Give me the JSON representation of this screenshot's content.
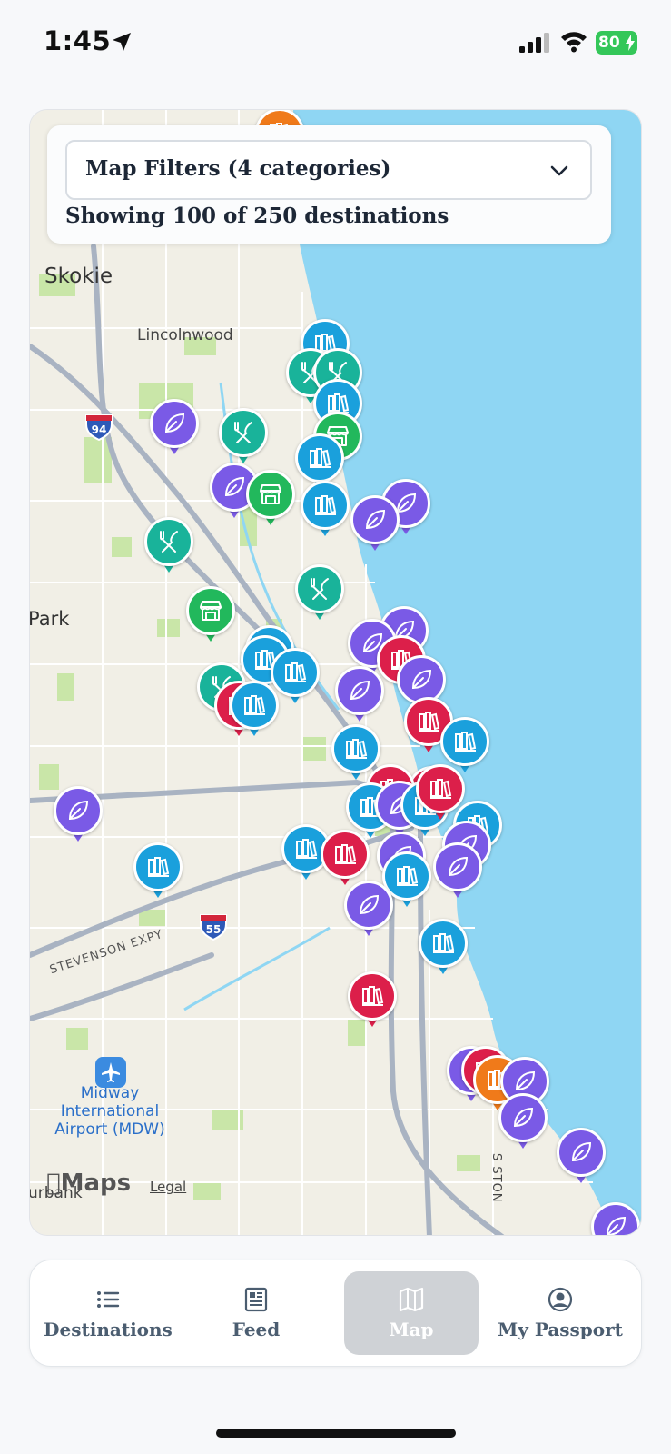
{
  "status_bar": {
    "time": "1:45",
    "battery": "80",
    "icons": [
      "location-arrow-icon",
      "cellular-signal-icon",
      "wifi-icon",
      "battery-charging-icon"
    ]
  },
  "map": {
    "labels": {
      "skokie": "Skokie",
      "lincolnwood": "Lincolnwood",
      "park": "Park",
      "stevenson": "STEVENSON EXPY",
      "midway_line1": "Midway",
      "midway_line2": "International",
      "midway_line3": "Airport (MDW)",
      "s_ston": "S STON",
      "urbank": "urbank"
    },
    "shields": {
      "i94": "94",
      "i55": "55"
    },
    "attribution": {
      "maps": "Maps",
      "legal": "Legal"
    }
  },
  "filters": {
    "select_label": "Map Filters (4 categories)",
    "showing": "Showing 100 of 250 destinations"
  },
  "pin_categories": {
    "museum": {
      "color": "#1aa0dc",
      "icon": "books-icon"
    },
    "museum_red": {
      "color": "#dc1f4a",
      "icon": "books-icon"
    },
    "museum_orange": {
      "color": "#f07a1a",
      "icon": "books-icon"
    },
    "dining": {
      "color": "#19b39a",
      "icon": "fork-knife-icon"
    },
    "shop": {
      "color": "#22b85c",
      "icon": "storefront-icon"
    },
    "park": {
      "color": "#7a5ae6",
      "icon": "leaf-icon"
    }
  },
  "tabs": [
    {
      "label": "Destinations",
      "icon": "list-icon",
      "selected": false
    },
    {
      "label": "Feed",
      "icon": "newspaper-icon",
      "selected": false
    },
    {
      "label": "Map",
      "icon": "map-icon",
      "selected": true
    },
    {
      "label": "My Passport",
      "icon": "user-circle-icon",
      "selected": false
    }
  ]
}
